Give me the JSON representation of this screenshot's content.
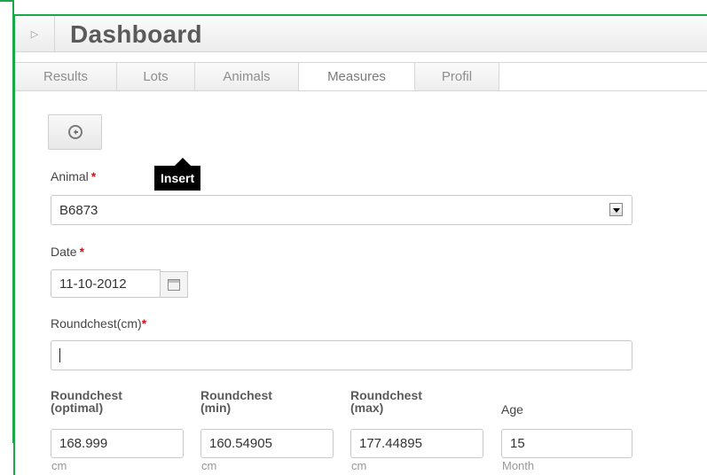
{
  "header": {
    "title": "Dashboard",
    "expand_glyph": "▷"
  },
  "tabs": [
    {
      "label": "Results"
    },
    {
      "label": "Lots"
    },
    {
      "label": "Animals"
    },
    {
      "label": "Measures"
    },
    {
      "label": "Profil"
    }
  ],
  "active_tab": "Measures",
  "back_button": {
    "icon": "back-arrow-circle-icon"
  },
  "tooltip": {
    "text": "Insert"
  },
  "form": {
    "animal": {
      "label": "Animal",
      "required": "*",
      "value": "B6873"
    },
    "date": {
      "label": "Date",
      "required": "*",
      "value": "11-10-2012",
      "icon": "calendar-icon"
    },
    "roundchest": {
      "label": "Roundchest(cm)",
      "required": "*",
      "value": ""
    },
    "optimal": {
      "label_line1": "Roundchest",
      "label_line2": "(optimal)",
      "value": "168.999",
      "unit": "cm"
    },
    "min": {
      "label_line1": "Roundchest",
      "label_line2": "(min)",
      "value": "160.54905",
      "unit": "cm"
    },
    "max": {
      "label_line1": "Roundchest",
      "label_line2": "(max)",
      "value": "177.44895",
      "unit": "cm"
    },
    "age": {
      "label": "Age",
      "value": "15",
      "unit": "Month"
    }
  },
  "colors": {
    "frame_border": "#1aa84a",
    "required": "#d0101a"
  }
}
